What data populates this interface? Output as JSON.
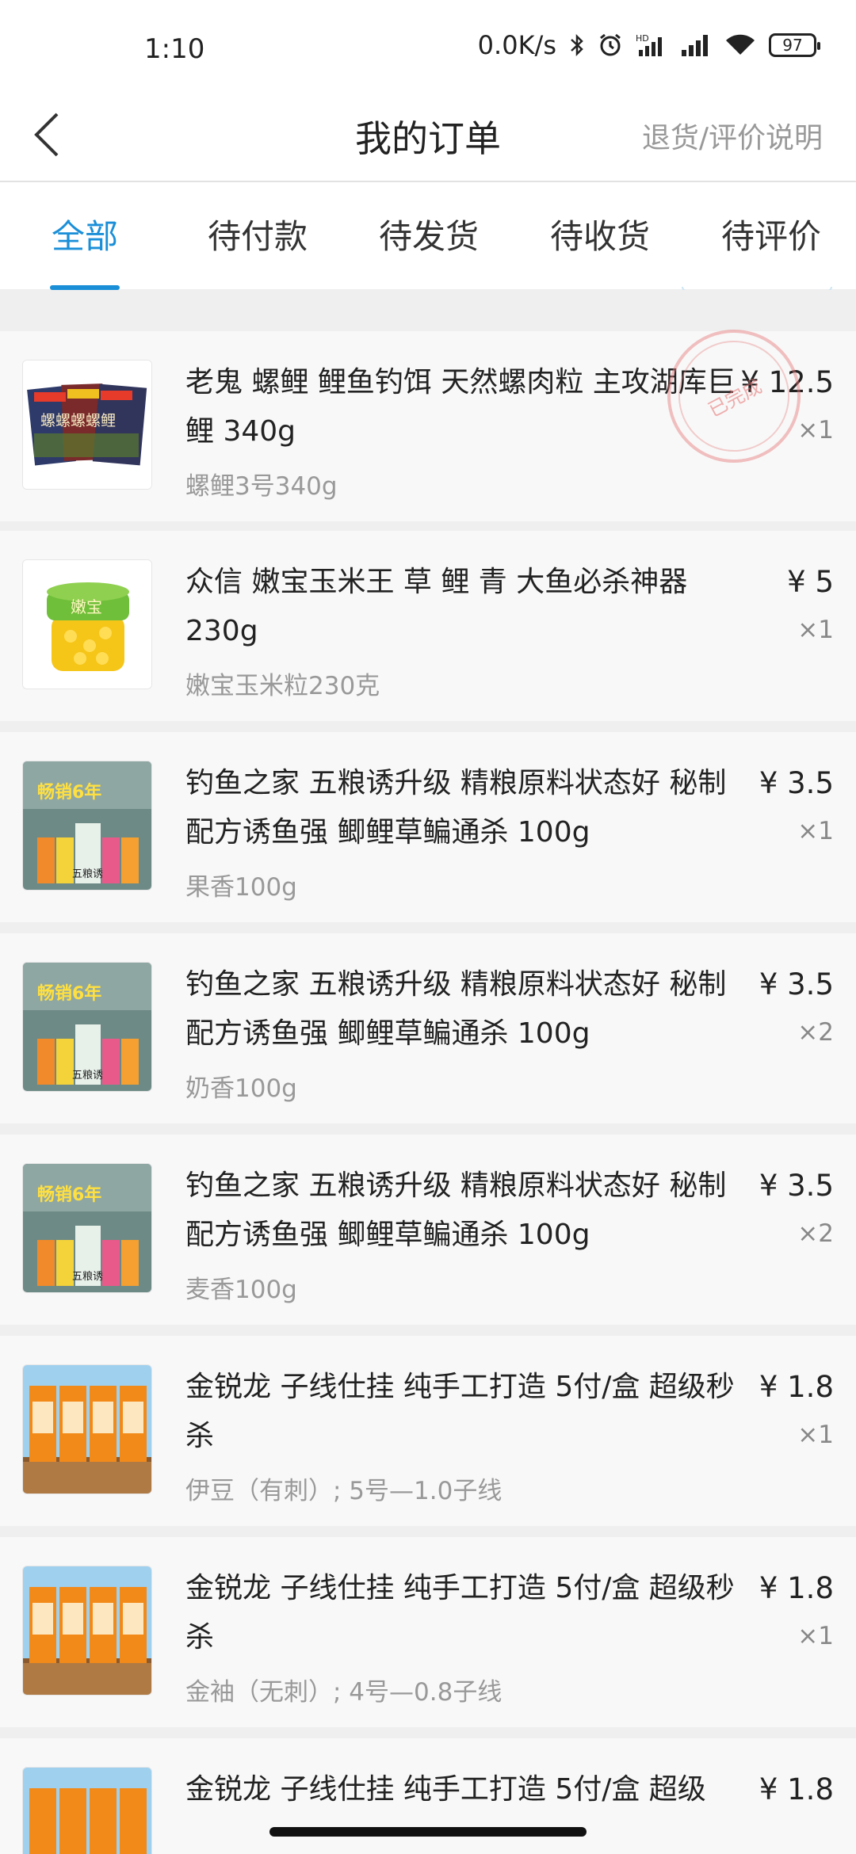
{
  "status_bar": {
    "time": "1:10",
    "net_speed": "0.0K/s",
    "battery": "97",
    "icons": [
      "bluetooth-icon",
      "alarm-icon",
      "hd-signal-icon",
      "signal-icon",
      "wifi-icon",
      "battery-icon"
    ]
  },
  "header": {
    "title": "我的订单",
    "right_link": "退货/评价说明",
    "back_icon": "chevron-left-icon"
  },
  "tabs": [
    {
      "label": "全部",
      "active": true
    },
    {
      "label": "待付款",
      "active": false
    },
    {
      "label": "待发货",
      "active": false
    },
    {
      "label": "待收货",
      "active": false
    },
    {
      "label": "待评价",
      "active": false
    }
  ],
  "order": {
    "stamp_text": "已完成",
    "items": [
      {
        "name": "老鬼 螺鲤 鲤鱼钓饵 天然螺肉粒 主攻湖库巨鲤 340g",
        "spec": "螺鲤3号340g",
        "price": "¥ 12.5",
        "qty": "×1",
        "thumb": "bait-bag"
      },
      {
        "name": "众信 嫩宝玉米王 草 鲤 青 大鱼必杀神器 230g",
        "spec": "嫩宝玉米粒230克",
        "price": "¥ 5",
        "qty": "×1",
        "thumb": "corn-jar"
      },
      {
        "name": "钓鱼之家 五粮诱升级 精粮原料状态好 秘制配方诱鱼强 鲫鲤草鳊通杀 100g",
        "spec": "果香100g",
        "price": "¥ 3.5",
        "qty": "×1",
        "thumb": "grain-bags"
      },
      {
        "name": "钓鱼之家 五粮诱升级 精粮原料状态好 秘制配方诱鱼强 鲫鲤草鳊通杀 100g",
        "spec": "奶香100g",
        "price": "¥ 3.5",
        "qty": "×2",
        "thumb": "grain-bags"
      },
      {
        "name": "钓鱼之家 五粮诱升级 精粮原料状态好 秘制配方诱鱼强 鲫鲤草鳊通杀 100g",
        "spec": "麦香100g",
        "price": "¥ 3.5",
        "qty": "×2",
        "thumb": "grain-bags"
      },
      {
        "name": "金锐龙 子线仕挂 纯手工打造 5付/盒 超级秒杀",
        "spec": "伊豆（有刺）; 5号—1.0子线",
        "price": "¥ 1.8",
        "qty": "×1",
        "thumb": "hook-boxes"
      },
      {
        "name": "金锐龙 子线仕挂 纯手工打造 5付/盒 超级秒杀",
        "spec": "金袖（无刺）; 4号—0.8子线",
        "price": "¥ 1.8",
        "qty": "×1",
        "thumb": "hook-boxes"
      },
      {
        "name": "金锐龙 子线仕挂 纯手工打造 5付/盒 超级",
        "spec": "",
        "price": "¥ 1.8",
        "qty": "",
        "thumb": "hook-boxes"
      }
    ]
  },
  "thumb_texts": {
    "bait_bag": "螺螺螺螺鲤",
    "corn_jar": "嫩宝",
    "grain_badge": "畅销6年",
    "grain_label": "五粮诱"
  }
}
